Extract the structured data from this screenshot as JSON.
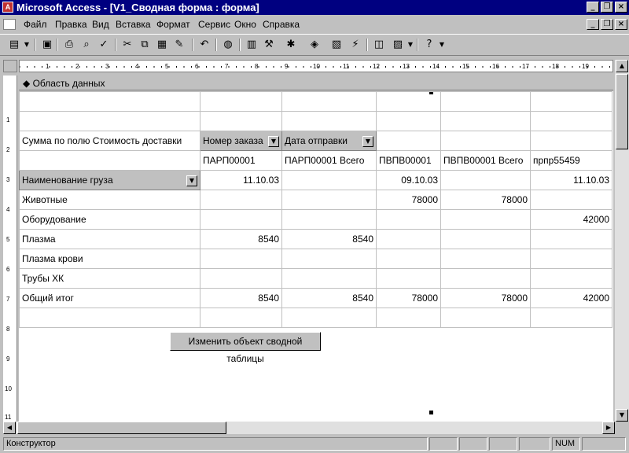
{
  "window": {
    "title": "Microsoft Access - [V1_Сводная форма : форма]",
    "minimize_glyph": "_",
    "restore_glyph": "❐",
    "close_glyph": "×"
  },
  "menu": {
    "items": [
      "Файл",
      "Правка",
      "Вид",
      "Вставка",
      "Формат",
      "Сервис",
      "Окно",
      "Справка"
    ]
  },
  "ruler": {
    "top_numbers": [
      "1",
      "2",
      "3",
      "4",
      "5",
      "6",
      "7",
      "8",
      "9",
      "10",
      "11",
      "12",
      "13",
      "14",
      "15",
      "16",
      "17",
      "18",
      "19"
    ],
    "left_numbers": [
      "1",
      "2",
      "3",
      "4",
      "5",
      "6",
      "7",
      "8",
      "9",
      "10",
      "11"
    ]
  },
  "section": {
    "label": "Область данных",
    "glyph": "◆"
  },
  "pivot": {
    "data_field": "Сумма по полю Стоимость доставки",
    "col_field_1": "Номер заказа",
    "col_field_2": "Дата отправки",
    "row_field": "Наименование груза",
    "col_headers": [
      "ПАРП00001",
      "ПАРП00001 Всего",
      "ПВПВ00001",
      "ПВПВ00001 Всего",
      "прпр55459"
    ],
    "dates": [
      "11.10.03",
      "",
      "09.10.03",
      "",
      "11.10.03"
    ],
    "rows": [
      {
        "label": "Животные",
        "values": [
          "",
          "",
          "78000",
          "78000",
          ""
        ]
      },
      {
        "label": "Оборудование",
        "values": [
          "",
          "",
          "",
          "",
          "42000"
        ]
      },
      {
        "label": "Плазма",
        "values": [
          "8540",
          "8540",
          "",
          "",
          ""
        ]
      },
      {
        "label": "Плазма крови",
        "values": [
          "",
          "",
          "",
          "",
          ""
        ]
      },
      {
        "label": "Трубы ХК",
        "values": [
          "",
          "",
          "",
          "",
          ""
        ]
      }
    ],
    "total": {
      "label": "Общий итог",
      "values": [
        "8540",
        "8540",
        "78000",
        "78000",
        "42000"
      ]
    }
  },
  "edit_button": "Изменить объект сводной таблицы",
  "status": {
    "mode": "Конструктор",
    "num": "NUM"
  }
}
